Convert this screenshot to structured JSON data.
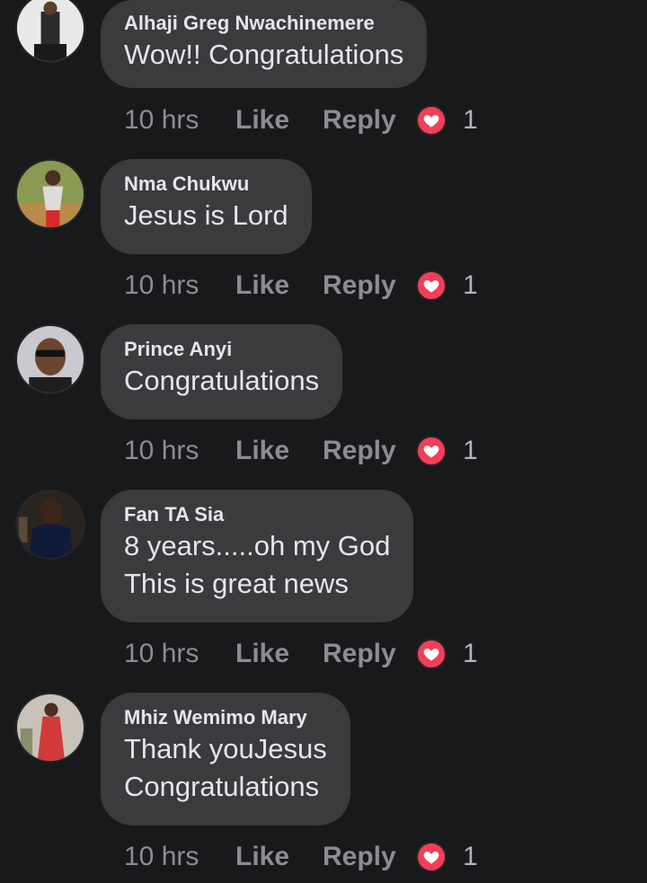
{
  "colors": {
    "background": "#18191a",
    "bubble": "#3a3b3c",
    "text": "#e4e6eb",
    "meta": "#8a8d91",
    "heart": "#f33e58"
  },
  "comments": [
    {
      "author": "Alhaji Greg Nwachinemere",
      "text": "Wow!! Congratulations",
      "time": "10 hrs",
      "like_label": "Like",
      "reply_label": "Reply",
      "reaction_icon": "heart-icon",
      "reaction_count": "1"
    },
    {
      "author": "Nma Chukwu",
      "text": "Jesus is Lord",
      "time": "10 hrs",
      "like_label": "Like",
      "reply_label": "Reply",
      "reaction_icon": "heart-icon",
      "reaction_count": "1"
    },
    {
      "author": "Prince Anyi",
      "text": "Congratulations",
      "time": "10 hrs",
      "like_label": "Like",
      "reply_label": "Reply",
      "reaction_icon": "heart-icon",
      "reaction_count": "1"
    },
    {
      "author": "Fan TA Sia",
      "text": "8 years.....oh my God\nThis is great news",
      "time": "10 hrs",
      "like_label": "Like",
      "reply_label": "Reply",
      "reaction_icon": "heart-icon",
      "reaction_count": "1"
    },
    {
      "author": "Mhiz Wemimo Mary",
      "text": "Thank youJesus\nCongratulations",
      "time": "10 hrs",
      "like_label": "Like",
      "reply_label": "Reply",
      "reaction_icon": "heart-icon",
      "reaction_count": "1"
    }
  ]
}
